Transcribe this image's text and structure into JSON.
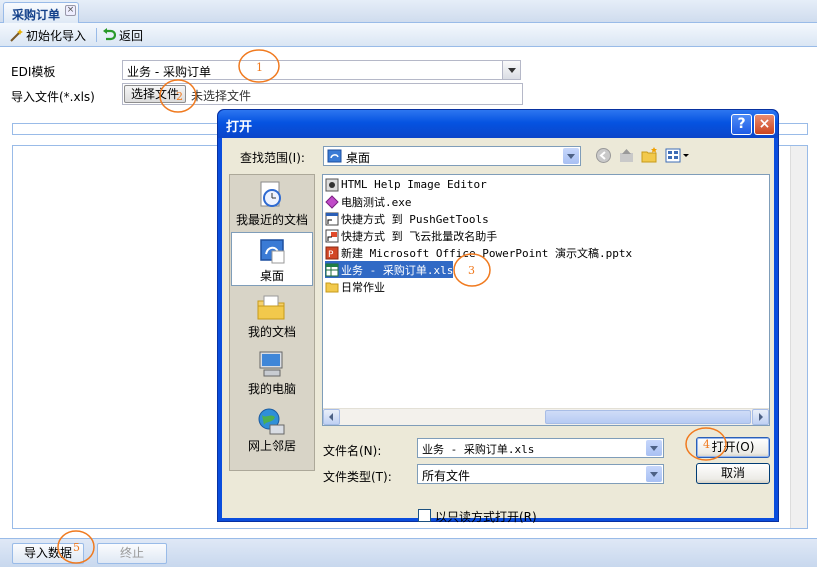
{
  "tab": {
    "title": "采购订单"
  },
  "toolbar": {
    "init_import_label": "初始化导入",
    "back_label": "返回"
  },
  "form": {
    "edi_template_label": "EDI模板",
    "edi_template_value": "业务 - 采购订单",
    "import_file_label": "导入文件(*.xls)",
    "choose_file_button": "选择文件",
    "no_file_text": "未选择文件"
  },
  "bottom": {
    "import_data_button": "导入数据",
    "stop_button": "终止"
  },
  "dialog": {
    "title": "打开",
    "help_button": "?",
    "close_button": "×",
    "look_in_label": "查找范围(I):",
    "look_in_value": "桌面",
    "places": [
      {
        "label": "我最近的文档",
        "icon": "recent-documents-icon"
      },
      {
        "label": "桌面",
        "icon": "desktop-icon"
      },
      {
        "label": "我的文档",
        "icon": "my-documents-icon"
      },
      {
        "label": "我的电脑",
        "icon": "my-computer-icon"
      },
      {
        "label": "网上邻居",
        "icon": "network-places-icon"
      }
    ],
    "files": [
      {
        "name": "HTML Help Image Editor",
        "icon": "shortcut-app-icon"
      },
      {
        "name": "电脑测试.exe",
        "icon": "exe-icon"
      },
      {
        "name": "快捷方式 到 PushGetTools",
        "icon": "shortcut-icon"
      },
      {
        "name": "快捷方式 到 飞云批量改名助手",
        "icon": "shortcut-icon"
      },
      {
        "name": "新建 Microsoft Office PowerPoint 演示文稿.pptx",
        "icon": "pptx-icon"
      },
      {
        "name": "业务 - 采购订单.xls",
        "icon": "xls-icon",
        "selected": true
      },
      {
        "name": "日常作业",
        "icon": "folder-icon"
      }
    ],
    "filename_label": "文件名(N):",
    "filename_value": "业务 - 采购订单.xls",
    "filetype_label": "文件类型(T):",
    "filetype_value": "所有文件",
    "open_button": "打开(O)",
    "cancel_button": "取消",
    "readonly_label": "以只读方式打开(R)"
  },
  "annotations": [
    "1",
    "2",
    "3",
    "4",
    "5"
  ],
  "colors": {
    "annotation": "#f07a1f",
    "selection": "#316ac5",
    "title_bar": "#0553e1"
  }
}
